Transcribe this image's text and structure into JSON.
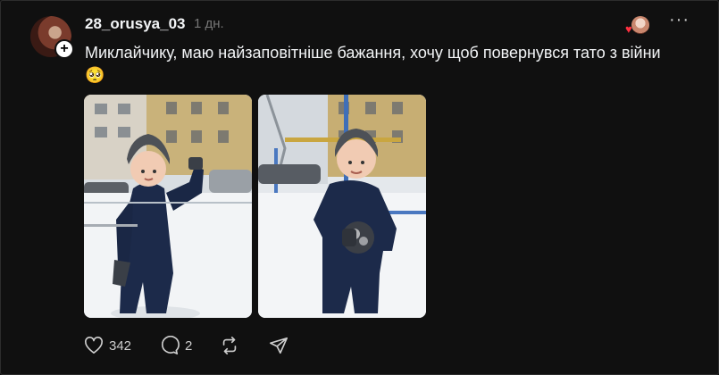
{
  "post": {
    "username": "28_orusya_03",
    "timestamp": "1 дн.",
    "text": "Миклайчику, маю найзаповітніше бажання, хочу щоб повернувся тато з війни🥺",
    "follow_symbol": "+",
    "more_symbol": "···",
    "images": [
      {
        "icon": "photo-child-snow-waving"
      },
      {
        "icon": "photo-child-snow-holding-snowball"
      }
    ]
  },
  "actions": {
    "like_count": "342",
    "reply_count": "2",
    "repost_icon": "repost-icon",
    "share_icon": "share-icon"
  },
  "colors": {
    "background": "#101010",
    "text": "#f3f5f7",
    "muted": "#777777",
    "heart": "#ff3040"
  }
}
